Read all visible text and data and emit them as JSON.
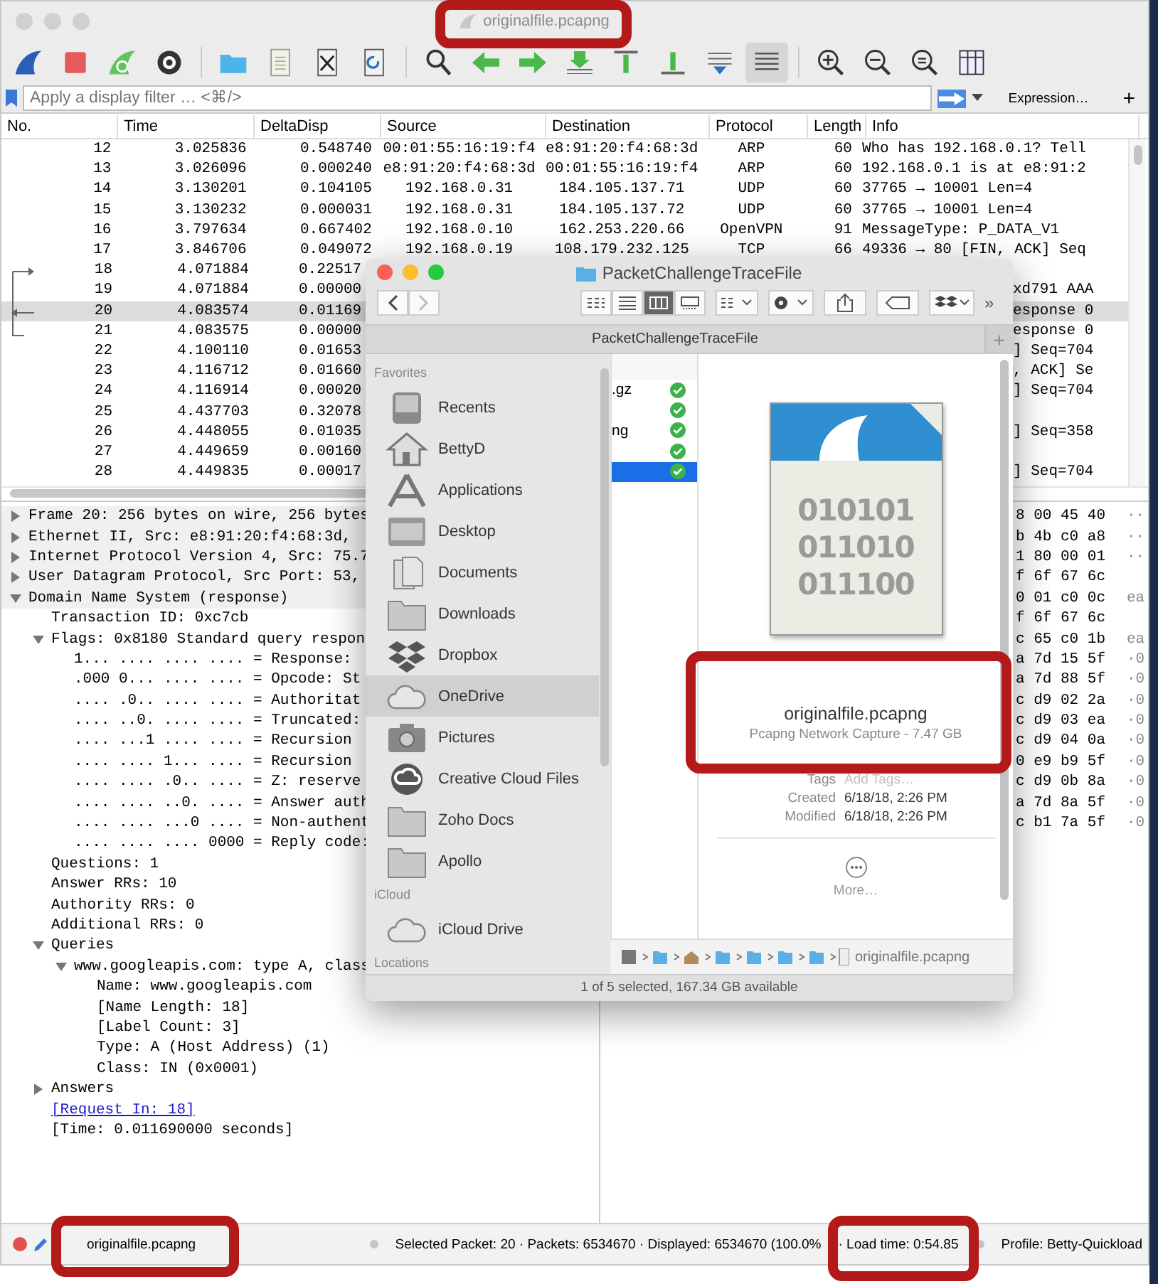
{
  "window": {
    "title": "originalfile.pcapng"
  },
  "toolbar": {
    "colorize_pressed": true
  },
  "filter": {
    "placeholder": "Apply a display filter … <⌘/>",
    "expression": "Expression…",
    "add": "+"
  },
  "packet_list": {
    "columns": [
      "No.",
      "Time",
      "DeltaDisp",
      "Source",
      "Destination",
      "Protocol",
      "Length",
      "Info"
    ],
    "rows": [
      {
        "no": "12",
        "time": "3.025836",
        "delta": "0.548740",
        "source": "00:01:55:16:19:f4",
        "destination": "e8:91:20:f4:68:3d",
        "protocol": "ARP",
        "length": "60",
        "info": "Who has 192.168.0.1? Tell",
        "selected": false
      },
      {
        "no": "13",
        "time": "3.026096",
        "delta": "0.000240",
        "source": "e8:91:20:f4:68:3d",
        "destination": "00:01:55:16:19:f4",
        "protocol": "ARP",
        "length": "60",
        "info": "192.168.0.1 is at e8:91:2",
        "selected": false
      },
      {
        "no": "14",
        "time": "3.130201",
        "delta": "0.104105",
        "source": "192.168.0.31",
        "destination": "184.105.137.71",
        "protocol": "UDP",
        "length": "60",
        "info": "37765 → 10001 Len=4",
        "selected": false
      },
      {
        "no": "15",
        "time": "3.130232",
        "delta": "0.000031",
        "source": "192.168.0.31",
        "destination": "184.105.137.72",
        "protocol": "UDP",
        "length": "60",
        "info": "37765 → 10001 Len=4",
        "selected": false
      },
      {
        "no": "16",
        "time": "3.797634",
        "delta": "0.667402",
        "source": "192.168.0.10",
        "destination": "162.253.220.66",
        "protocol": "OpenVPN",
        "length": "91",
        "info": "MessageType: P_DATA_V1",
        "selected": false
      },
      {
        "no": "17",
        "time": "3.846706",
        "delta": "0.049072",
        "source": "192.168.0.19",
        "destination": "108.179.232.125",
        "protocol": "TCP",
        "length": "66",
        "info": "49336 → 80 [FIN, ACK] Seq",
        "selected": false
      },
      {
        "no": "18",
        "time": "4.071884",
        "delta": "0.22517",
        "selected": false
      },
      {
        "no": "19",
        "time": "4.071884",
        "delta": "0.00000",
        "info": "xd791 AAA",
        "selected": false
      },
      {
        "no": "20",
        "time": "4.083574",
        "delta": "0.01169",
        "info": "esponse 0",
        "selected": true
      },
      {
        "no": "21",
        "time": "4.083575",
        "delta": "0.00000",
        "info": "esponse 0",
        "selected": false
      },
      {
        "no": "22",
        "time": "4.100110",
        "delta": "0.01653",
        "info": "] Seq=704",
        "selected": false
      },
      {
        "no": "23",
        "time": "4.116712",
        "delta": "0.01660",
        "info": ", ACK] Se",
        "selected": false
      },
      {
        "no": "24",
        "time": "4.116914",
        "delta": "0.00020",
        "info": "] Seq=704",
        "selected": false
      },
      {
        "no": "25",
        "time": "4.437703",
        "delta": "0.32078",
        "selected": false
      },
      {
        "no": "26",
        "time": "4.448055",
        "delta": "0.01035",
        "info": "] Seq=358",
        "selected": false
      },
      {
        "no": "27",
        "time": "4.449659",
        "delta": "0.00160",
        "selected": false
      },
      {
        "no": "28",
        "time": "4.449835",
        "delta": "0.00017",
        "info": "] Seq=704",
        "selected": false
      }
    ]
  },
  "details": [
    {
      "text": "Frame 20: 256 bytes on wire, 256 bytes",
      "expanded": false
    },
    {
      "text": "Ethernet II, Src: e8:91:20:f4:68:3d,",
      "expanded": false
    },
    {
      "text": "Internet Protocol Version 4, Src: 75.7",
      "expanded": false
    },
    {
      "text": "User Datagram Protocol, Src Port: 53,",
      "expanded": false
    },
    {
      "text": "Domain Name System (response)",
      "expanded": true,
      "children": [
        {
          "text": "Transaction ID: 0xc7cb"
        },
        {
          "text": "Flags: 0x8180 Standard query respon",
          "expanded": true,
          "children": [
            {
              "text": "1... .... .... .... = Response:"
            },
            {
              "text": ".000 0... .... .... = Opcode: St"
            },
            {
              "text": ".... .0.. .... .... = Authoritat"
            },
            {
              "text": ".... ..0. .... .... = Truncated:"
            },
            {
              "text": ".... ...1 .... .... = Recursion"
            },
            {
              "text": ".... .... 1... .... = Recursion"
            },
            {
              "text": ".... .... .0.. .... = Z: reserve"
            },
            {
              "text": ".... .... ..0. .... = Answer auth"
            },
            {
              "text": ".... .... ...0 .... = Non-authent"
            },
            {
              "text": ".... .... .... 0000 = Reply code:"
            }
          ]
        },
        {
          "text": "Questions: 1"
        },
        {
          "text": "Answer RRs: 10"
        },
        {
          "text": "Authority RRs: 0"
        },
        {
          "text": "Additional RRs: 0"
        },
        {
          "text": "Queries",
          "expanded": true,
          "children": [
            {
              "text": "www.googleapis.com: type A, class",
              "expanded": true,
              "children": [
                {
                  "text": "Name: www.googleapis.com"
                },
                {
                  "text": "[Name Length: 18]"
                },
                {
                  "text": "[Label Count: 3]"
                },
                {
                  "text": "Type: A (Host Address) (1)"
                },
                {
                  "text": "Class: IN (0x0001)"
                }
              ]
            }
          ]
        },
        {
          "text": "Answers",
          "expanded": false
        },
        {
          "text": "[Request In: 18]",
          "kind": "link"
        },
        {
          "text": "[Time: 0.011690000 seconds]"
        }
      ]
    }
  ],
  "bytes": [
    {
      "hex": "8 00 45 40",
      "ascii": "··"
    },
    {
      "hex": "b 4b c0 a8",
      "ascii": "··"
    },
    {
      "hex": "1 80 00 01",
      "ascii": "··"
    },
    {
      "hex": "f 6f 67 6c"
    },
    {
      "hex": "0 01 c0 0c",
      "ascii": "ea"
    },
    {
      "hex": "f 6f 67 6c"
    },
    {
      "hex": "c 65 c0 1b",
      "ascii": "ea"
    },
    {
      "hex": "a 7d 15 5f",
      "ascii": "·0"
    },
    {
      "hex": "a 7d 88 5f",
      "ascii": "·0"
    },
    {
      "hex": "c d9 02 2a",
      "ascii": "·0"
    },
    {
      "hex": "c d9 03 ea",
      "ascii": "·0"
    },
    {
      "hex": "c d9 04 0a",
      "ascii": "·0"
    },
    {
      "hex": "0 e9 b9 5f",
      "ascii": "·0"
    },
    {
      "hex": "c d9 0b 8a",
      "ascii": "·0"
    },
    {
      "hex": "a 7d 8a 5f",
      "ascii": "·0"
    },
    {
      "hex": "c b1 7a 5f",
      "ascii": "·0"
    }
  ],
  "status_bar": {
    "file": "originalfile.pcapng",
    "packets": "Selected Packet: 20 · Packets: 6534670 · Displayed: 6534670 (100.0%",
    "load_time": "· Load time: 0:54.85",
    "profile": "Profile: Betty-Quickload"
  },
  "finder": {
    "title": "PacketChallengeTraceFile",
    "path_title": "PacketChallengeTraceFile",
    "add": "+",
    "more": "»",
    "sidebar": [
      {
        "kind": "heading",
        "label": "Favorites"
      },
      {
        "kind": "recents",
        "label": "Recents",
        "selected": false
      },
      {
        "kind": "home",
        "label": "BettyD",
        "selected": false
      },
      {
        "kind": "applications",
        "label": "Applications",
        "selected": false
      },
      {
        "kind": "desktop",
        "label": "Desktop",
        "selected": false
      },
      {
        "kind": "documents",
        "label": "Documents",
        "selected": false
      },
      {
        "kind": "folder",
        "label": "Downloads",
        "selected": false
      },
      {
        "kind": "dropbox",
        "label": "Dropbox",
        "selected": false
      },
      {
        "kind": "cloud",
        "label": "OneDrive",
        "selected": true
      },
      {
        "kind": "camera",
        "label": "Pictures",
        "selected": false
      },
      {
        "kind": "creative-cloud",
        "label": "Creative Cloud Files",
        "selected": false
      },
      {
        "kind": "folder",
        "label": "Zoho Docs",
        "selected": false
      },
      {
        "kind": "folder",
        "label": "Apollo",
        "selected": false
      },
      {
        "kind": "heading",
        "label": "iCloud"
      },
      {
        "kind": "cloud",
        "label": "iCloud Drive",
        "selected": false
      },
      {
        "kind": "heading",
        "label": "Locations"
      }
    ],
    "files": [
      {
        "name": ".gz",
        "synced": true,
        "selected": false
      },
      {
        "synced": true,
        "selected": false
      },
      {
        "name": "ng",
        "synced": true,
        "selected": false
      },
      {
        "synced": true,
        "selected": false
      },
      {
        "synced": true,
        "selected": true
      }
    ],
    "preview": {
      "binary": [
        "010101",
        "011010",
        "011100"
      ],
      "name": "originalfile.pcapng",
      "kind": "Pcapng Network Capture - 7.47 GB",
      "info": [
        {
          "label": "Tags",
          "placeholder": "Add Tags…"
        },
        {
          "label": "Created",
          "value": "6/18/18, 2:26 PM"
        },
        {
          "label": "Modified",
          "value": "6/18/18, 2:26 PM"
        }
      ],
      "more": "More…"
    },
    "path_file": "originalfile.pcapng",
    "status": "1 of 5 selected, 167.34 GB available"
  }
}
